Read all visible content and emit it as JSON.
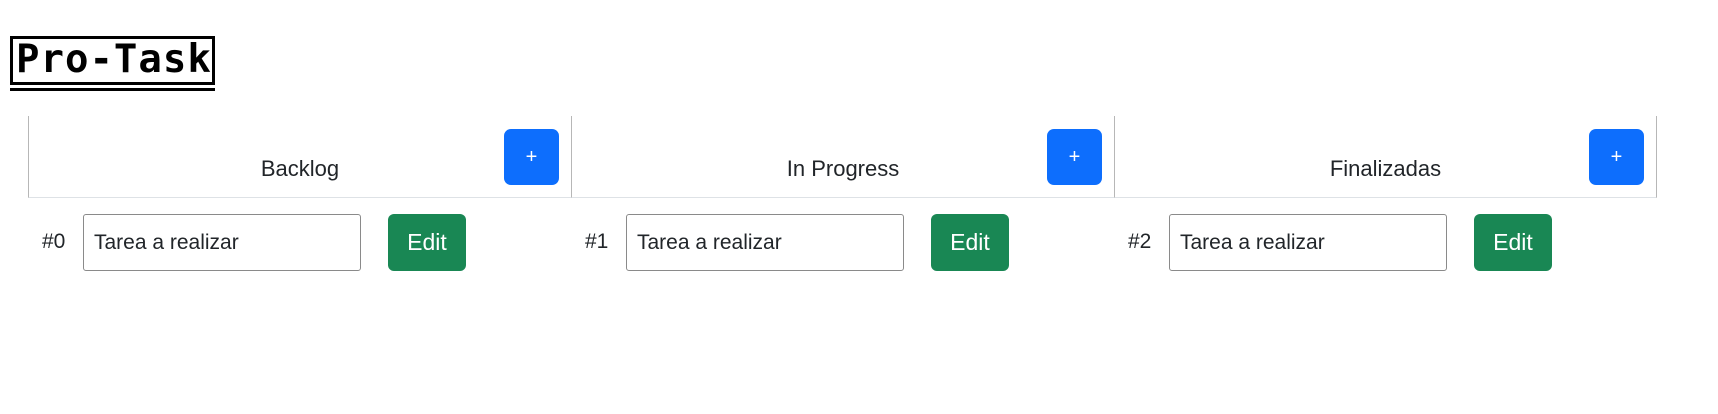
{
  "app": {
    "logo_text": "Pro-Task"
  },
  "columns": [
    {
      "title": "Backlog",
      "add_label": "+",
      "tasks": [
        {
          "id": "#0",
          "value": "Tarea a realizar",
          "edit_label": "Edit"
        }
      ]
    },
    {
      "title": "In Progress",
      "add_label": "+",
      "tasks": [
        {
          "id": "#1",
          "value": "Tarea a realizar",
          "edit_label": "Edit"
        }
      ]
    },
    {
      "title": "Finalizadas",
      "add_label": "+",
      "tasks": [
        {
          "id": "#2",
          "value": "Tarea a realizar",
          "edit_label": "Edit"
        }
      ]
    }
  ],
  "colors": {
    "primary": "#0d6efd",
    "success": "#198754"
  }
}
